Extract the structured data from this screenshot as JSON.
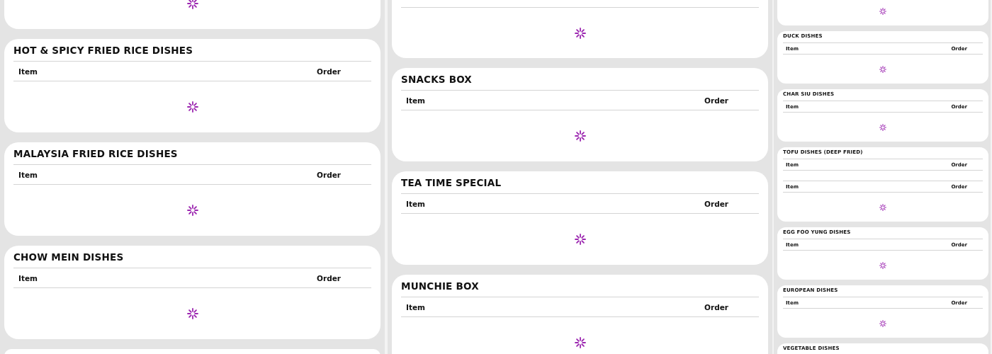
{
  "columns": [
    {
      "kind": "wide",
      "cards": [
        {
          "kind": "cut_top",
          "loading": true
        },
        {
          "kind": "full",
          "title": "HOT & SPICY FRIED RICE DISHES",
          "header_rows": [
            {
              "item": "Item",
              "order": "Order"
            }
          ],
          "loading": true
        },
        {
          "kind": "full",
          "title": "MALAYSIA FRIED RICE DISHES",
          "header_rows": [
            {
              "item": "Item",
              "order": "Order"
            }
          ],
          "loading": true
        },
        {
          "kind": "full",
          "title": "CHOW MEIN DISHES",
          "header_rows": [
            {
              "item": "Item",
              "order": "Order"
            }
          ],
          "loading": true
        },
        {
          "kind": "cut_bottom"
        }
      ]
    },
    {
      "kind": "wide",
      "cards": [
        {
          "kind": "cut_header",
          "loading": true
        },
        {
          "kind": "full",
          "title": "SNACKS BOX",
          "header_rows": [
            {
              "item": "Item",
              "order": "Order"
            }
          ],
          "loading": true
        },
        {
          "kind": "full",
          "title": "TEA TIME SPECIAL",
          "header_rows": [
            {
              "item": "Item",
              "order": "Order"
            }
          ],
          "loading": true
        },
        {
          "kind": "full",
          "title": "MUNCHIE BOX",
          "header_rows": [
            {
              "item": "Item",
              "order": "Order"
            }
          ],
          "loading": true
        }
      ]
    },
    {
      "kind": "narrow",
      "cards": [
        {
          "kind": "cut_top",
          "loading": true
        },
        {
          "kind": "full",
          "title": "DUCK DISHES",
          "header_rows": [
            {
              "item": "Item",
              "order": "Order"
            }
          ],
          "loading": true
        },
        {
          "kind": "full",
          "title": "CHAR SIU DISHES",
          "header_rows": [
            {
              "item": "Item",
              "order": "Order"
            }
          ],
          "loading": true
        },
        {
          "kind": "full",
          "title": "TOFU DISHES (DEEP FRIED)",
          "header_rows": [
            {
              "item": "Item",
              "order": "Order"
            },
            {
              "item": "Item",
              "order": "Order"
            }
          ],
          "loading": true
        },
        {
          "kind": "full",
          "title": "EGG FOO YUNG DISHES",
          "header_rows": [
            {
              "item": "Item",
              "order": "Order"
            }
          ],
          "loading": true
        },
        {
          "kind": "full",
          "title": "EUROPEAN DISHES",
          "header_rows": [
            {
              "item": "Item",
              "order": "Order"
            }
          ],
          "loading": true
        },
        {
          "kind": "cut_bottom",
          "title": "VEGETABLE DISHES"
        }
      ]
    }
  ]
}
